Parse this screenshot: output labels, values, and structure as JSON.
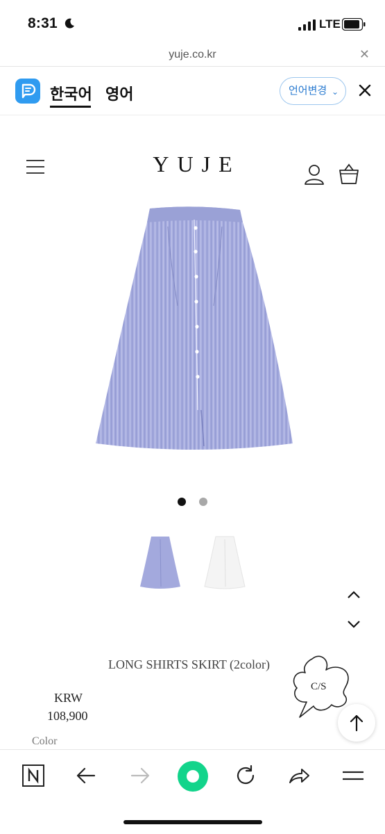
{
  "status_bar": {
    "time": "8:31",
    "network": "LTE"
  },
  "url_bar": {
    "url": "yuje.co.kr",
    "close_symbol": "✕"
  },
  "translate_bar": {
    "languages": [
      "한국어",
      "영어"
    ],
    "change_button": "언어변경",
    "chevron": "⌄"
  },
  "site": {
    "brand": "YUJE"
  },
  "carousel": {
    "total_slides": 2,
    "active_index": 0
  },
  "product": {
    "name": "LONG SHIRTS SKIRT (2color)",
    "currency": "KRW",
    "price": "108,900",
    "color_label": "Color",
    "thumbnails": [
      "blue-stripe",
      "white"
    ]
  },
  "cs_badge": {
    "label": "C/S"
  },
  "icons": {
    "moon": "moon-icon",
    "signal": "signal-icon",
    "battery": "battery-icon",
    "hamburger": "menu-icon",
    "user": "user-icon",
    "cart": "shopping-bag-icon",
    "scroll_top": "arrow-up-icon"
  },
  "colors": {
    "accent_blue": "#2f9bf0",
    "naver_green": "#12d48b",
    "skirt_blue": "#a3a9dd"
  }
}
